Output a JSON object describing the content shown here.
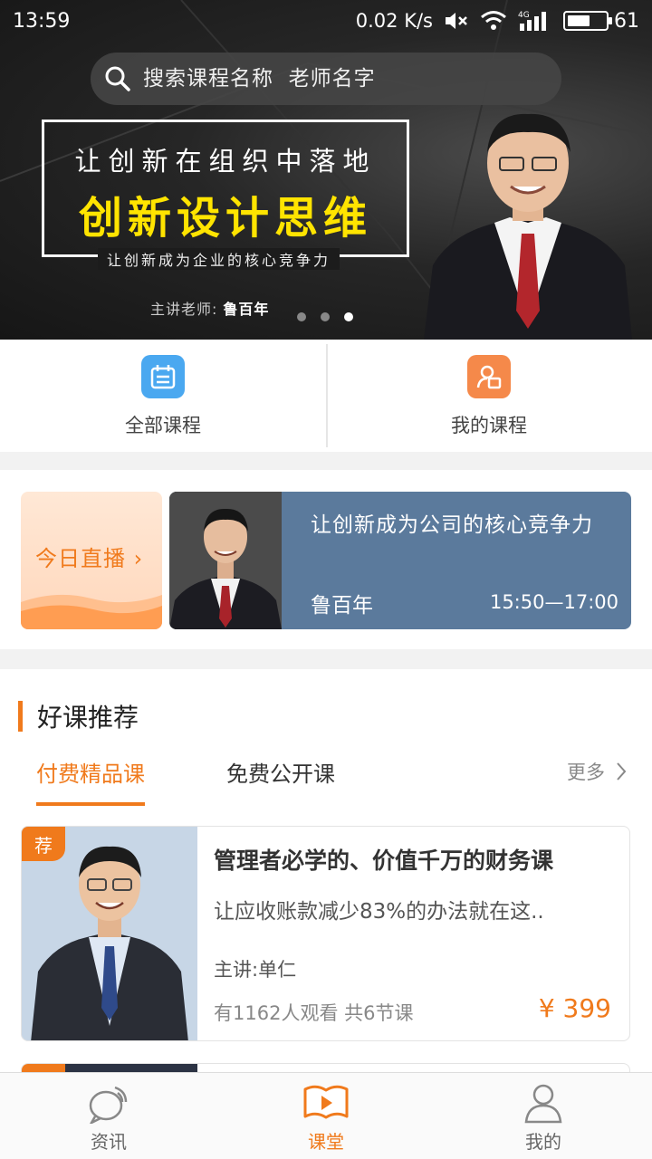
{
  "status_bar": {
    "time": "13:59",
    "network_speed": "0.02 K/s",
    "signal_label": "4G",
    "battery_level": "61",
    "battery_fraction": 0.61
  },
  "search": {
    "placeholder": "搜索课程名称  老师名字"
  },
  "banner": {
    "line1": "让创新在组织中落地",
    "line2": "创新设计思维",
    "tagline": "让创新成为企业的核心竞争力",
    "teacher_label": "主讲老师:",
    "teacher_name": "鲁百年",
    "slide_count": 3,
    "active_slide": 3
  },
  "quick_nav": {
    "all_courses": "全部课程",
    "my_courses": "我的课程",
    "colors": {
      "all": "#4aa8f0",
      "mine": "#f5894a"
    }
  },
  "live": {
    "today_label": "今日直播",
    "title": "让创新成为公司的核心竞争力",
    "teacher": "鲁百年",
    "time": "15:50—17:00"
  },
  "recommend": {
    "section_title": "好课推荐",
    "tabs": [
      "付费精品课",
      "免费公开课"
    ],
    "active_tab": 0,
    "more_label": "更多",
    "course": {
      "badge": "荐",
      "title": "管理者必学的、价值千万的财务课",
      "desc": "让应收账款减少83%的办法就在这..",
      "teacher": "主讲:单仁",
      "meta": "有1162人观看  共6节课",
      "price": "¥ 399"
    }
  },
  "bottom_nav": {
    "items": [
      {
        "label": "资讯",
        "icon": "news-bubble-icon"
      },
      {
        "label": "课堂",
        "icon": "classroom-book-icon"
      },
      {
        "label": "我的",
        "icon": "profile-icon"
      }
    ],
    "active": 1,
    "accent": "#f07a1c"
  }
}
